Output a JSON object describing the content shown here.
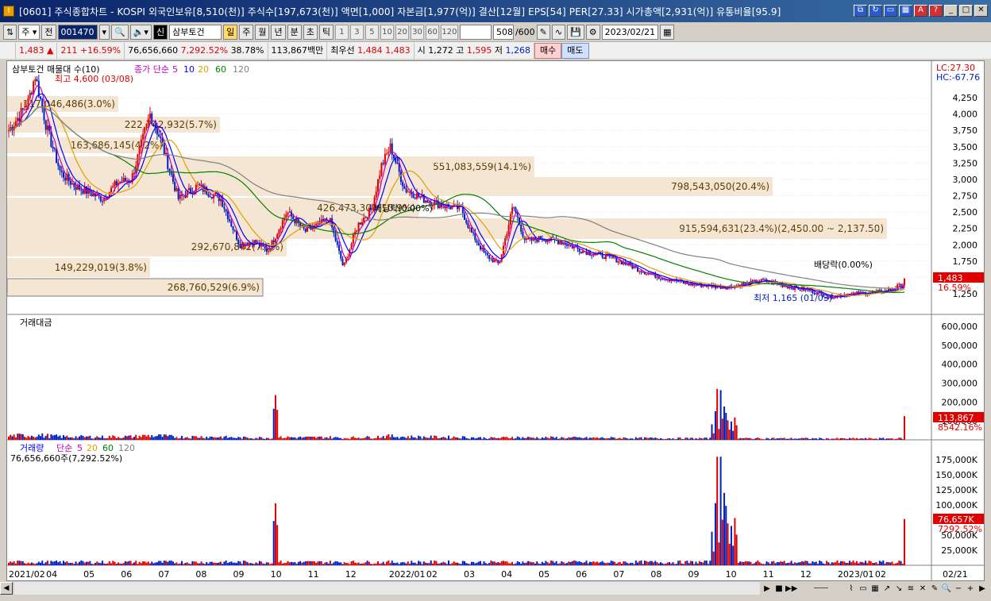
{
  "window": {
    "title": "[0601] 주식종합차트 - KOSPI 외국인보유[8,510(천)] 주식수[197,673(천)] 액면[1,000] 자본금[1,977(억)] 결산[12월] EPS[54] PER[27.33] 시가총액[2,931(억)] 유통비율[95.9]",
    "app_icon": "I"
  },
  "toolbar": {
    "market": "주",
    "scope": "전",
    "code": "001470",
    "name": "삼부토건",
    "name_prefix": "신",
    "periods": [
      "일",
      "주",
      "월",
      "년",
      "분",
      "초",
      "틱"
    ],
    "active_period": "일",
    "intervals": [
      "1",
      "3",
      "5",
      "10",
      "20",
      "30",
      "60",
      "120"
    ],
    "count": "508",
    "count_total": "/600",
    "date": "2023/02/21"
  },
  "infobar": {
    "price": "1,483",
    "change": "211",
    "change_pct": "+16.59%",
    "volume": "76,656,660",
    "volume_pct": "7,292.52%",
    "turnover": "38.78%",
    "amount": "113,867백만",
    "best_label": "최우선",
    "best_ask": "1,484",
    "best_bid": "1,483",
    "open_label": "시",
    "open": "1,272",
    "high_label": "고",
    "high": "1,595",
    "low_label": "저",
    "low": "1,268",
    "buy": "매수",
    "sell": "매도"
  },
  "price_panel": {
    "legend_name": "삼부토건 매물대 수(10)",
    "legend_ma": "종가 단순",
    "ma_periods": [
      "5",
      "10",
      "20",
      "60",
      "120"
    ],
    "max_label": "최고 4,600 (03/08)",
    "min_label": "최저 1,165 (01/03)",
    "lc": "LC:27.30",
    "hc": "HC:-67.76",
    "last_price": "1,483",
    "last_pct": "16.59%",
    "ticks": [
      "4,250",
      "4,000",
      "3,750",
      "3,500",
      "3,250",
      "3,000",
      "2,750",
      "2,500",
      "2,250",
      "2,000",
      "1,750",
      "1,500",
      "1,250"
    ],
    "volume_profile": [
      {
        "label": "117,046,486(3.0%)"
      },
      {
        "label": "222,742,932(5.7%)"
      },
      {
        "label": "163,686,145(4.2%)"
      },
      {
        "label": "551,083,559(14.1%)"
      },
      {
        "label": "798,543,050(20.4%)"
      },
      {
        "label": "426,473,309(10.9%)"
      },
      {
        "label": "915,594,631(23.4%)(2,450.00 ~ 2,137.50)"
      },
      {
        "label": "292,670,842(7.5%)"
      },
      {
        "label": "149,229,019(3.8%)"
      },
      {
        "label": "268,760,529(6.9%)"
      }
    ],
    "dividend_labels": [
      "배당락(0.00%)",
      "배당락(0.00%)"
    ]
  },
  "amount_panel": {
    "title": "거래대금",
    "ticks": [
      "600,000",
      "500,000",
      "400,000",
      "300,000",
      "200,000",
      "100,000"
    ],
    "last_value": "113,867",
    "last_pct": "8542.16%"
  },
  "volume_panel": {
    "title": "거래량",
    "ma_label": "단순",
    "ma_periods": [
      "5",
      "20",
      "60",
      "120"
    ],
    "current": "76,656,660주(7,292.52%)",
    "ticks": [
      "175,000K",
      "150,000K",
      "125,000K",
      "100,000K",
      "75,000K",
      "50,000K",
      "25,000K"
    ],
    "last_value": "76,657K",
    "last_pct": "7292.52%"
  },
  "xaxis": {
    "labels": [
      "2021/02",
      "04",
      "05",
      "06",
      "07",
      "08",
      "09",
      "10",
      "11",
      "12",
      "2022/01",
      "02",
      "03",
      "04",
      "05",
      "06",
      "07",
      "08",
      "09",
      "10",
      "11",
      "12",
      "2023/01",
      "02"
    ],
    "right_label": "02/21"
  },
  "colors": {
    "up": "#e00000",
    "down": "#0020c0",
    "ma5": "#c000c0",
    "ma10": "#0000ff",
    "ma20": "#e0a000",
    "ma60": "#008000",
    "ma120": "#808080"
  }
}
